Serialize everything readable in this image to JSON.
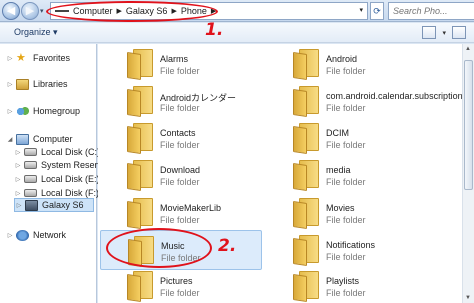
{
  "address_bar": {
    "crumbs": [
      "Computer",
      "Galaxy S6",
      "Phone"
    ],
    "search_placeholder": "Search Pho..."
  },
  "toolbar": {
    "organize_label": "Organize",
    "organize_arrow": "▾"
  },
  "sidebar": {
    "items": [
      {
        "label": "Favorites",
        "icon": "star-icon"
      },
      {
        "label": "Libraries",
        "icon": "library-icon"
      },
      {
        "label": "Homegroup",
        "icon": "homegroup-icon"
      },
      {
        "label": "Computer",
        "icon": "computer-icon"
      },
      {
        "label": "Local Disk (C:)",
        "icon": "disk-icon"
      },
      {
        "label": "System Reserved (D:)",
        "icon": "disk-icon"
      },
      {
        "label": "Local Disk (E:)",
        "icon": "disk-icon"
      },
      {
        "label": "Local Disk (F:)",
        "icon": "disk-icon"
      },
      {
        "label": "Galaxy S6",
        "icon": "phone-icon",
        "selected": true
      },
      {
        "label": "Network",
        "icon": "network-icon"
      }
    ]
  },
  "folders": [
    {
      "name": "Alarms",
      "type": "File folder"
    },
    {
      "name": "Android",
      "type": "File folder"
    },
    {
      "name": "Androidカレンダー",
      "type": "File folder"
    },
    {
      "name": "com.android.calendar.subscription.a",
      "type": "File folder"
    },
    {
      "name": "Contacts",
      "type": "File folder"
    },
    {
      "name": "DCIM",
      "type": "File folder"
    },
    {
      "name": "Download",
      "type": "File folder"
    },
    {
      "name": "media",
      "type": "File folder"
    },
    {
      "name": "MovieMakerLib",
      "type": "File folder"
    },
    {
      "name": "Movies",
      "type": "File folder"
    },
    {
      "name": "Music",
      "type": "File folder",
      "selected": true
    },
    {
      "name": "Notifications",
      "type": "File folder"
    },
    {
      "name": "Pictures",
      "type": "File folder"
    },
    {
      "name": "Playlists",
      "type": "File folder"
    }
  ],
  "annotations": {
    "step1": "1.",
    "step2": "2."
  },
  "colors": {
    "annotation_red": "#e0121b",
    "selection_blue": "#dcebfb",
    "folder_yellow": "#f5cf62"
  }
}
